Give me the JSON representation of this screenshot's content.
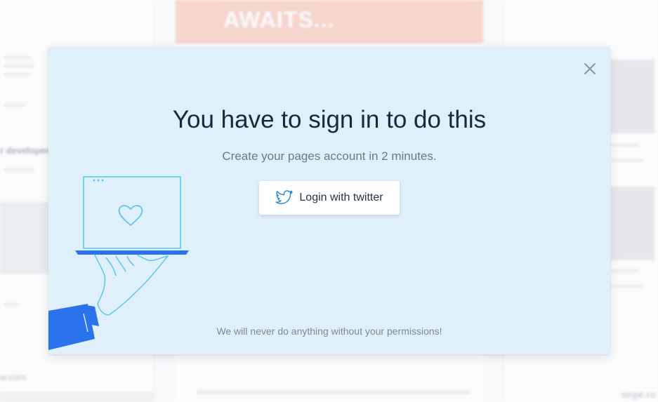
{
  "modal": {
    "title": "You have to sign in to do this",
    "subtitle": "Create your pages account in 2 minutes.",
    "login_button_label": "Login with twitter",
    "footer_note": "We will never do anything without your permissions!"
  },
  "background": {
    "hero_text": "AWAITS...",
    "left_text_1": "r developers",
    "left_text_2": "w.com",
    "right_text": "stripe.co"
  },
  "icons": {
    "close": "close-icon",
    "twitter": "twitter-bird-icon",
    "illustration": "laptop-on-hand-illustration"
  },
  "colors": {
    "modal_bg": "#dff0fb",
    "accent_blue": "#2b73ec",
    "line_blue": "#5cc6ee",
    "twitter_blue": "#2f8bd1",
    "title_text": "#17293a"
  }
}
